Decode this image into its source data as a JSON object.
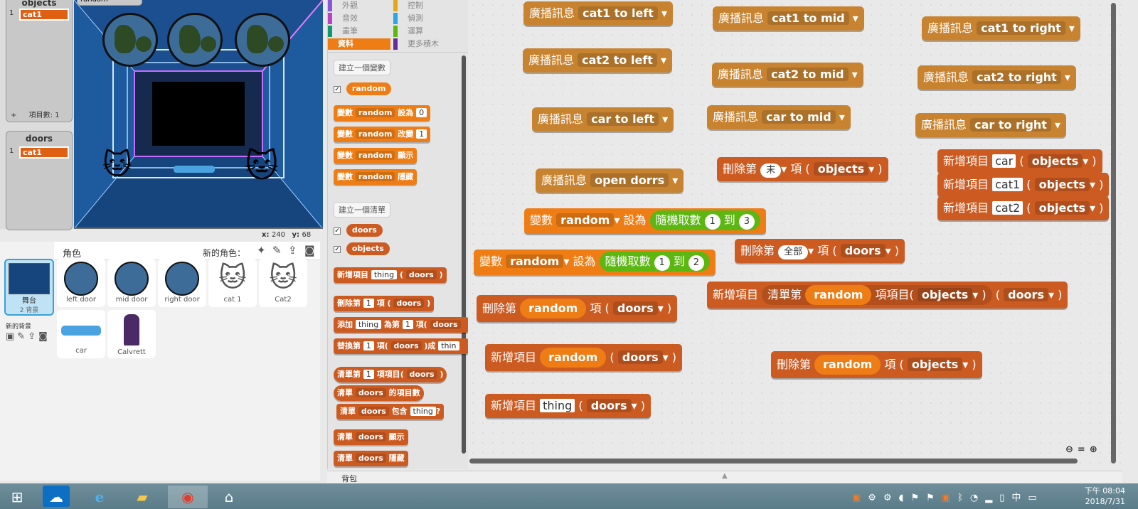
{
  "stage": {
    "objects_list_title": "objects",
    "objects_item_index": "1",
    "objects_item": "cat1",
    "objects_count": "項目數: 1",
    "doors_list_title": "doors",
    "doors_item_index": "1",
    "doors_item": "cat1",
    "var_monitor_label": "random",
    "coord_x_label": "x:",
    "coord_x": "240",
    "coord_y_label": "y:",
    "coord_y": "68"
  },
  "sprites": {
    "header": "角色",
    "new_sprite_label": "新的角色：",
    "stage_name": "舞台",
    "stage_backdrops": "2 背景",
    "new_backdrop_label": "新的背景",
    "items": [
      {
        "name": "left door"
      },
      {
        "name": "mid door"
      },
      {
        "name": "right door"
      },
      {
        "name": "cat 1"
      },
      {
        "name": "Cat2"
      },
      {
        "name": "car"
      },
      {
        "name": "Calvrett"
      }
    ]
  },
  "palette": {
    "categories": [
      "外觀",
      "控制",
      "音效",
      "偵測",
      "畫筆",
      "運算",
      "資料",
      "更多積木"
    ],
    "make_variable": "建立一個變數",
    "var_name": "random",
    "b_set": [
      "變數",
      "random",
      "設為",
      "0"
    ],
    "b_change": [
      "變數",
      "random",
      "改變",
      "1"
    ],
    "b_show": [
      "變數",
      "random",
      "顯示"
    ],
    "b_hide": [
      "變數",
      "random",
      "隱藏"
    ],
    "make_list": "建立一個清單",
    "list1": "doors",
    "list2": "objects",
    "lb_add": [
      "新增項目",
      "thing",
      "doors"
    ],
    "lb_delete": [
      "刪除第",
      "1",
      "項",
      "doors"
    ],
    "lb_insert": [
      "添加",
      "thing",
      "為第",
      "1",
      "項",
      "doors"
    ],
    "lb_replace": [
      "替換第",
      "1",
      "項",
      "doors",
      "成",
      "thin"
    ],
    "lb_item": [
      "清單第",
      "1",
      "項項目",
      "doors"
    ],
    "lb_length": [
      "清單",
      "doors",
      "的項目數"
    ],
    "lb_contains": [
      "清單",
      "doors",
      "包含",
      "thing",
      "?"
    ],
    "lb_show": [
      "清單",
      "doors",
      "顯示"
    ],
    "lb_hide": [
      "清單",
      "doors",
      "隱藏"
    ]
  },
  "scripts": {
    "broadcast": "廣播訊息",
    "msgs": [
      "cat1 to left",
      "cat1 to mid",
      "cat1 to right",
      "cat2 to left",
      "cat2 to mid",
      "cat2 to right",
      "car to left",
      "car to mid",
      "car to right",
      "open dorrs"
    ],
    "delete_item": "刪除第",
    "item_suffix": "項",
    "last_opt": "末",
    "all_opt": "全部",
    "objects": "objects",
    "doors": "doors",
    "add_item": "新增項目",
    "car": "car",
    "cat1": "cat1",
    "cat2": "cat2",
    "var_label": "變數",
    "random": "random",
    "set_to": "設為",
    "pick_random": "隨機取數",
    "to_word": "到",
    "n1": "1",
    "n3": "3",
    "n2": "2",
    "list_item_of": "清單第",
    "item_of": "項項目(",
    "thing": "thing",
    "open_paren": "(",
    "close_paren": ")"
  },
  "backpack": "背包",
  "taskbar": {
    "time": "下午 08:04",
    "date": "2018/7/31",
    "ime": "中"
  }
}
